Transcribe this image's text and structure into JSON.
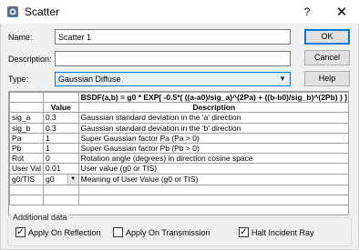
{
  "window": {
    "title": "Scatter",
    "help_glyph": "?",
    "close_glyph": "✕"
  },
  "form": {
    "name_label": "Name:",
    "name_value": "Scatter 1",
    "description_label": "Description:",
    "description_value": "",
    "type_label": "Type:",
    "type_value": "Gaussian Diffuse"
  },
  "buttons": {
    "ok": "OK",
    "cancel": "Cancel",
    "help": "Help"
  },
  "table": {
    "formula": "BSDF(a,b) = g0 * EXP[ -0.5*( ((a-a0)/sig_a)^(2Pa) + ((b-b0)/sig_b)^(2Pb) ) ]",
    "headers": [
      "",
      "Value",
      "Description"
    ],
    "rows": [
      {
        "name": "sig_a",
        "value": "0.3",
        "description": "Gaussian standard deviation in the 'a' direction"
      },
      {
        "name": "sig_b",
        "value": "0.3",
        "description": "Gaussian standard deviation in the 'b' direction"
      },
      {
        "name": "Pa",
        "value": "1",
        "description": "Super Gaussian factor Pa (Pa > 0)"
      },
      {
        "name": "Pb",
        "value": "1",
        "description": "Super Gaussian factor Pb (Pb > 0)"
      },
      {
        "name": "Rot",
        "value": "0",
        "description": "Rotation angle (degrees) in direction cosine space"
      },
      {
        "name": "User Val",
        "value": "0.01",
        "description": "User value (g0 or TIS)"
      },
      {
        "name": "g0/TIS",
        "value": "g0",
        "description": "Meaning of User Value  (g0 or TIS)"
      }
    ]
  },
  "additional": {
    "title": "Additional data",
    "apply_on_reflection": {
      "label": "Apply On Reflection",
      "checked": true,
      "mark": "✓"
    },
    "apply_on_transmission": {
      "label": "Apply On Transmission",
      "checked": false,
      "mark": ""
    },
    "halt_incident_ray": {
      "label": "Halt Incident Ray",
      "checked": true,
      "mark": "✓"
    }
  }
}
